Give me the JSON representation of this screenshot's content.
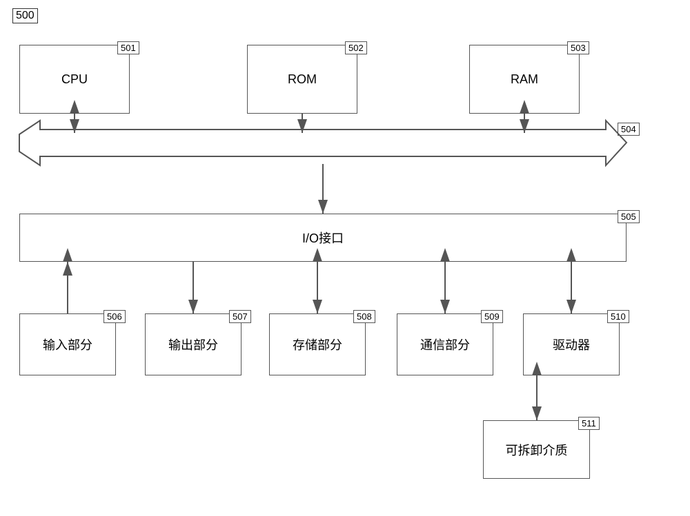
{
  "diagram": {
    "outer_label": "500",
    "components": [
      {
        "id": "cpu",
        "label": "CPU",
        "ref": "501"
      },
      {
        "id": "rom",
        "label": "ROM",
        "ref": "502"
      },
      {
        "id": "ram",
        "label": "RAM",
        "ref": "503"
      },
      {
        "id": "bus",
        "label": "",
        "ref": "504"
      },
      {
        "id": "io",
        "label": "I/O接口",
        "ref": "505"
      },
      {
        "id": "input",
        "label": "输入部分",
        "ref": "506"
      },
      {
        "id": "output",
        "label": "输出部分",
        "ref": "507"
      },
      {
        "id": "storage",
        "label": "存储部分",
        "ref": "508"
      },
      {
        "id": "comm",
        "label": "通信部分",
        "ref": "509"
      },
      {
        "id": "driver",
        "label": "驱动器",
        "ref": "510"
      },
      {
        "id": "media",
        "label": "可拆卸介质",
        "ref": "511"
      }
    ]
  }
}
